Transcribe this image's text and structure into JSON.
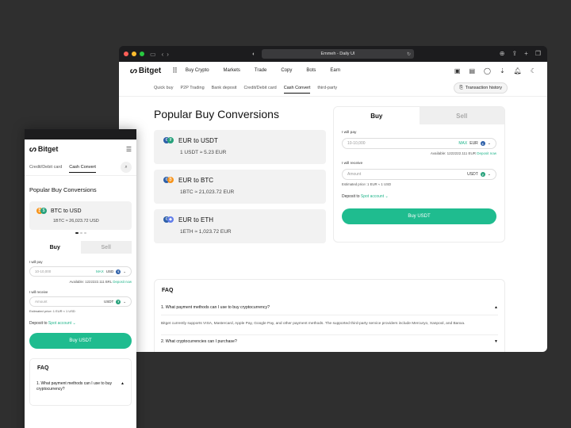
{
  "colors": {
    "accent": "#1fbc8f",
    "background": "#2f2f2f",
    "usdt": "#26a17b",
    "eur": "#2d5fa8",
    "btc": "#f7931a",
    "eth": "#627eea"
  },
  "browser": {
    "url": "Emmeh - Daily UI",
    "icons": [
      "sidebar-icon",
      "back-icon",
      "forward-icon",
      "shield-icon",
      "reload-icon",
      "download-icon",
      "share-icon",
      "new-tab-icon",
      "tabs-icon"
    ]
  },
  "brand": {
    "name": "Bitget"
  },
  "nav": {
    "items": [
      "Buy Crypto",
      "Markets",
      "Trade",
      "Copy",
      "Bots",
      "Earn"
    ]
  },
  "subnav": {
    "tabs": [
      "Quick buy",
      "P2P Trading",
      "Bank deposit",
      "Credit/Debit card",
      "Cash Convert",
      "third-party"
    ],
    "active": "Cash Convert",
    "tx_history": "Transaction history"
  },
  "main": {
    "title": "Popular Buy Conversions",
    "conversions": [
      {
        "title": "EUR to USDT",
        "rate": "1 USDT ≈ 5.23 EUR"
      },
      {
        "title": "EUR to BTC",
        "rate": "1BTC ≈ 21,023.72 EUR"
      },
      {
        "title": "EUR to ETH",
        "rate": "1ETH ≈ 1,023.72 EUR"
      }
    ]
  },
  "widget": {
    "buy_tab": "Buy",
    "sell_tab": "Sell",
    "pay_label": "I will pay",
    "pay_placeholder": "10-10,000",
    "max": "MAX",
    "pay_currency": "EUR",
    "available": "Available:",
    "available_value": "1222222.111 EUR",
    "deposit_now": "Deposit now",
    "receive_label": "I will receive",
    "receive_placeholder": "Amount",
    "receive_currency": "USDT",
    "estimated": "Estimated price: 1 EUR ≈ 1 USD",
    "deposit_to": "Deposit to",
    "account": "Spot account",
    "button": "Buy USDT"
  },
  "faq": {
    "title": "FAQ",
    "q1": "1. What payment methods can I use to buy cryptocurrency?",
    "a1": "Bitget currently supports VISA, Mastercard, Apple Pay, Google Pay, and other payment methods. The supported third-party service providers include Mercuryo, Xanpool, and Banxa.",
    "q2": "2. What cryptocurrencies can I purchase?"
  },
  "mobile": {
    "tabs": [
      "Credit/Debit card",
      "Cash Convert"
    ],
    "active": "Cash Convert",
    "title": "Popular Buy Conversions",
    "conversion": {
      "title": "BTC to USD",
      "rate": "1BTC ≈ 26,023.72 USD"
    },
    "pay_placeholder": "10-10,000",
    "max": "MAX",
    "pay_currency": "USD",
    "available_value": "1222222.111 BRL",
    "deposit_now": "Deposit now",
    "receive_placeholder": "Amount",
    "receive_currency": "USDT",
    "estimated": "Estimated price: 1 EUR ≈ 1 USD",
    "button": "Buy USDT",
    "faq_title": "FAQ",
    "faq_q1": "1. What payment methods can I use to buy cryptocurrency?"
  }
}
